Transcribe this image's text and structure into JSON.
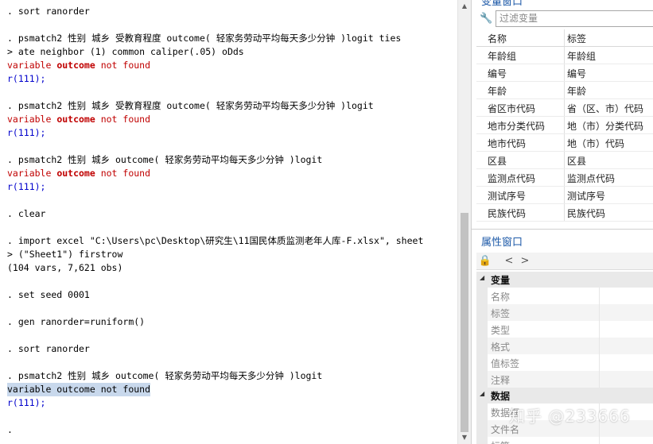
{
  "console": {
    "lines": [
      {
        "t": ". sort ranorder",
        "k": "cmd"
      },
      {
        "t": "",
        "k": "cmd"
      },
      {
        "t": ". psmatch2 性别 城乡 受教育程度 outcome( 轻家务劳动平均每天多少分钟 )logit ties",
        "k": "cmd"
      },
      {
        "t": "> ate neighbor (1) common caliper(.05) oDds",
        "k": "cmd"
      },
      {
        "t": "variable outcome not found",
        "k": "err"
      },
      {
        "t": "r(111);",
        "k": "rc"
      },
      {
        "t": "",
        "k": "cmd"
      },
      {
        "t": ". psmatch2 性别 城乡 受教育程度 outcome( 轻家务劳动平均每天多少分钟 )logit",
        "k": "cmd"
      },
      {
        "t": "variable outcome not found",
        "k": "err"
      },
      {
        "t": "r(111);",
        "k": "rc"
      },
      {
        "t": "",
        "k": "cmd"
      },
      {
        "t": ". psmatch2 性别 城乡 outcome( 轻家务劳动平均每天多少分钟 )logit",
        "k": "cmd"
      },
      {
        "t": "variable outcome not found",
        "k": "err"
      },
      {
        "t": "r(111);",
        "k": "rc"
      },
      {
        "t": "",
        "k": "cmd"
      },
      {
        "t": ". clear",
        "k": "cmd"
      },
      {
        "t": "",
        "k": "cmd"
      },
      {
        "t": ". import excel \"C:\\Users\\pc\\Desktop\\研究生\\11国民体质监测老年人库-F.xlsx\", sheet",
        "k": "cmd"
      },
      {
        "t": "> (\"Sheet1\") firstrow",
        "k": "cmd"
      },
      {
        "t": "(104 vars, 7,621 obs)",
        "k": "cmd"
      },
      {
        "t": "",
        "k": "cmd"
      },
      {
        "t": ". set seed 0001",
        "k": "cmd"
      },
      {
        "t": "",
        "k": "cmd"
      },
      {
        "t": ". gen ranorder=runiform()",
        "k": "cmd"
      },
      {
        "t": "",
        "k": "cmd"
      },
      {
        "t": ". sort ranorder",
        "k": "cmd"
      },
      {
        "t": "",
        "k": "cmd"
      },
      {
        "t": ". psmatch2 性别 城乡 outcome( 轻家务劳动平均每天多少分钟 )logit",
        "k": "cmd"
      },
      {
        "t": "variable outcome not found",
        "k": "hl"
      },
      {
        "t": "r(111);",
        "k": "rc"
      },
      {
        "t": "",
        "k": "cmd"
      },
      {
        "t": ".",
        "k": "cmd"
      }
    ]
  },
  "scrollbar": {
    "up_glyph": "▲",
    "down_glyph": "▼"
  },
  "variables_panel": {
    "title": "变量窗口",
    "filter_placeholder": "过滤变量",
    "filter_icon": "wrench-icon",
    "col_name": "名称",
    "col_label": "标签",
    "rows": [
      {
        "name": "年龄组",
        "label": "年龄组"
      },
      {
        "name": "编号",
        "label": "编号"
      },
      {
        "name": "年龄",
        "label": "年龄"
      },
      {
        "name": "省区市代码",
        "label": "省（区、市）代码"
      },
      {
        "name": "地市分类代码",
        "label": "地（市）分类代码"
      },
      {
        "name": "地市代码",
        "label": "地（市）代码"
      },
      {
        "name": "区县",
        "label": "区县"
      },
      {
        "name": "监测点代码",
        "label": "监测点代码"
      },
      {
        "name": "测试序号",
        "label": "测试序号"
      },
      {
        "name": "民族代码",
        "label": "民族代码"
      }
    ]
  },
  "properties_panel": {
    "title": "属性窗口",
    "toolbar": {
      "lock_glyph": "🔒",
      "back_glyph": "<",
      "forward_glyph": ">"
    },
    "groups": [
      {
        "label": "变量",
        "items": [
          "名称",
          "标签",
          "类型",
          "格式",
          "值标签",
          "注释"
        ]
      },
      {
        "label": "数据",
        "items": [
          "数据框",
          "文件名",
          "标签"
        ]
      }
    ]
  },
  "watermark": "知乎 @233666"
}
